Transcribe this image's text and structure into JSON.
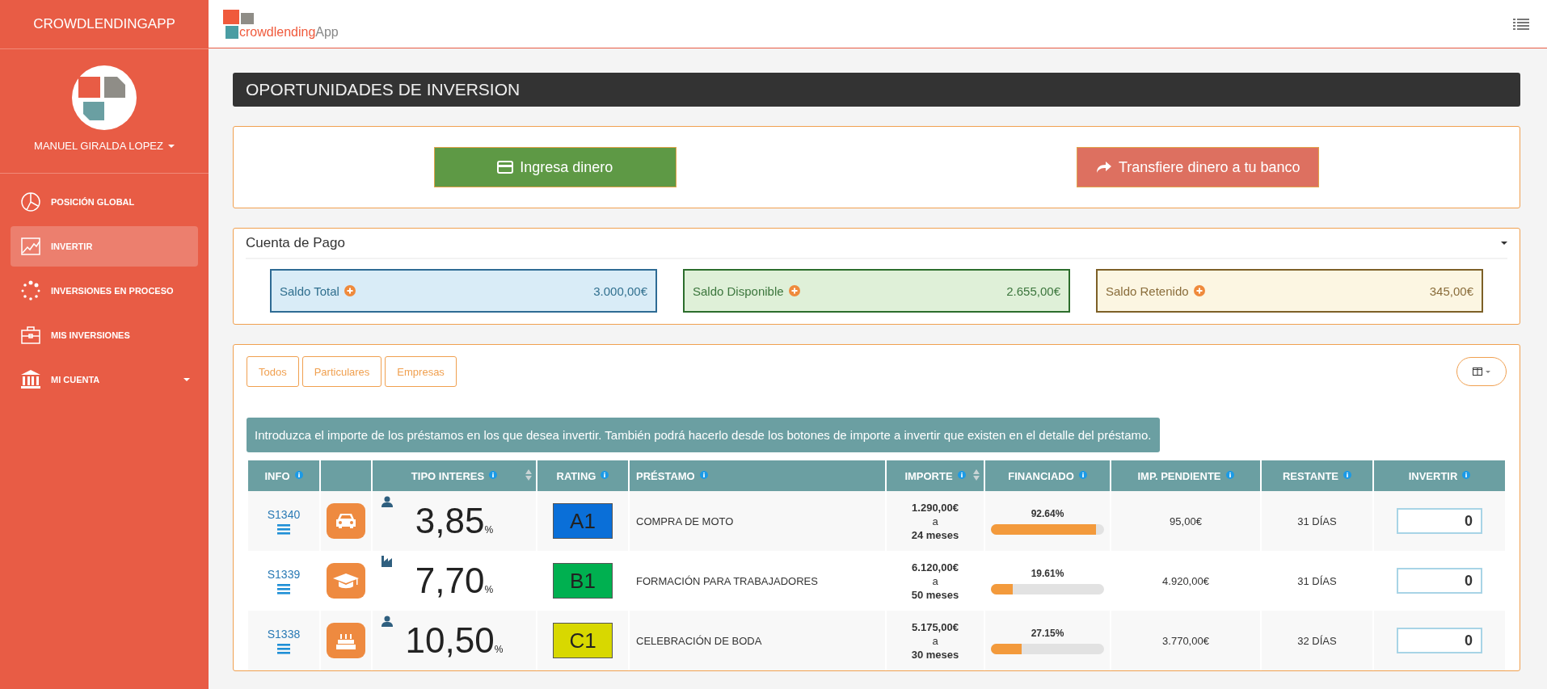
{
  "sidebar": {
    "brand": "CROWDLENDINGAPP",
    "user": "MANUEL GIRALDA LOPEZ",
    "items": [
      {
        "label": "POSICIÓN GLOBAL",
        "selected": false,
        "expandable": false
      },
      {
        "label": "INVERTIR",
        "selected": true,
        "expandable": false
      },
      {
        "label": "INVERSIONES EN PROCESO",
        "selected": false,
        "expandable": false
      },
      {
        "label": "MIS INVERSIONES",
        "selected": false,
        "expandable": false
      },
      {
        "label": "MI CUENTA",
        "selected": false,
        "expandable": true
      }
    ]
  },
  "topbar": {
    "logo_text_1": "crowdlending",
    "logo_text_2": "App"
  },
  "page_title": "OPORTUNIDADES DE INVERSION",
  "actions": [
    {
      "label": "Ingresa dinero",
      "kind": "deposit"
    },
    {
      "label": "Transfiere dinero a tu banco",
      "kind": "transfer"
    }
  ],
  "account": {
    "title": "Cuenta de Pago",
    "balances": [
      {
        "label": "Saldo Total",
        "value": "3.000,00€",
        "kind": "info"
      },
      {
        "label": "Saldo Disponible",
        "value": "2.655,00€",
        "kind": "success"
      },
      {
        "label": "Saldo Retenido",
        "value": "345,00€",
        "kind": "warning"
      }
    ]
  },
  "filters": [
    {
      "label": "Todos",
      "selected": false
    },
    {
      "label": "Particulares",
      "selected": false
    },
    {
      "label": "Empresas",
      "selected": false
    }
  ],
  "notice": "Introduzca el importe de los préstamos en los que desea invertir. También podrá hacerlo desde los botones de importe a invertir que existen en el detalle del préstamo.",
  "table": {
    "columns": [
      {
        "label": "INFO",
        "info": true,
        "sortable": false
      },
      {
        "info": false,
        "sortable": false
      },
      {
        "label": "TIPO INTERES",
        "info": true,
        "sortable": true
      },
      {
        "label": "RATING",
        "info": true,
        "sortable": false
      },
      {
        "label": "PRÉSTAMO",
        "info": true,
        "sortable": false
      },
      {
        "label": "IMPORTE",
        "info": true,
        "sortable": true
      },
      {
        "label": "FINANCIADO",
        "info": true,
        "sortable": false
      },
      {
        "label": "IMP. PENDIENTE",
        "info": true,
        "sortable": false
      },
      {
        "label": "RESTANTE",
        "info": true,
        "sortable": false
      },
      {
        "label": "INVERTIR",
        "info": true,
        "sortable": false
      }
    ],
    "rows": [
      {
        "id": "S1340",
        "category": {
          "kind": "car"
        },
        "borrower": {
          "kind": "person"
        },
        "rate": "3,85",
        "rate_unit": "%",
        "rating": "A1",
        "color": "#0a6fd8",
        "loan": "COMPRA DE MOTO",
        "amount": "1.290,00€",
        "amount_sep": "a",
        "term": "24 meses",
        "funded": "92.64%",
        "level": 0.9264,
        "pending": "95,00€",
        "remaining": "31 DÍAS",
        "invest": "0"
      },
      {
        "id": "S1339",
        "category": {
          "kind": "education"
        },
        "borrower": {
          "kind": "company"
        },
        "rate": "7,70",
        "rate_unit": "%",
        "rating": "B1",
        "color": "#00b050",
        "loan": "FORMACIÓN PARA TRABAJADORES",
        "amount": "6.120,00€",
        "amount_sep": "a",
        "term": "50 meses",
        "funded": "19.61%",
        "level": 0.1961,
        "pending": "4.920,00€",
        "remaining": "31 DÍAS",
        "invest": "0"
      },
      {
        "id": "S1338",
        "category": {
          "kind": "cake"
        },
        "borrower": {
          "kind": "person"
        },
        "rate": "10,50",
        "rate_unit": "%",
        "rating": "C1",
        "color": "#d8d800",
        "loan": "CELEBRACIÓN DE BODA",
        "amount": "5.175,00€",
        "amount_sep": "a",
        "term": "30 meses",
        "funded": "27.15%",
        "level": 0.2715,
        "pending": "3.770,00€",
        "remaining": "32 DÍAS",
        "invest": "0"
      }
    ]
  }
}
